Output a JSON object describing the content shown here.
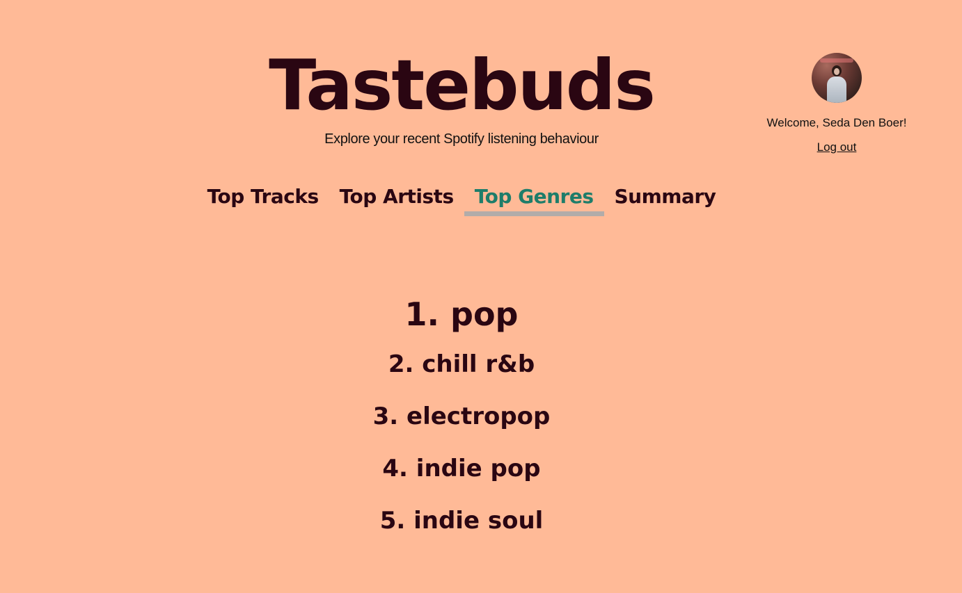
{
  "header": {
    "title": "Tastebuds",
    "subtitle": "Explore your recent Spotify listening behaviour"
  },
  "user": {
    "welcome": "Welcome, Seda Den Boer!",
    "logout_label": "Log out",
    "avatar_icon": "user-avatar-photo"
  },
  "nav": {
    "tabs": [
      {
        "label": "Top Tracks",
        "active": false
      },
      {
        "label": "Top Artists",
        "active": false
      },
      {
        "label": "Top Genres",
        "active": true
      },
      {
        "label": "Summary",
        "active": false
      }
    ]
  },
  "genres": {
    "items": [
      {
        "label": "1. pop"
      },
      {
        "label": "2. chill r&b"
      },
      {
        "label": "3. electropop"
      },
      {
        "label": "4. indie pop"
      },
      {
        "label": "5. indie soul"
      }
    ]
  },
  "colors": {
    "background": "#ffba97",
    "text": "#2a0612",
    "active_tab": "#1e7d6a",
    "active_underline": "#b2aca9"
  }
}
